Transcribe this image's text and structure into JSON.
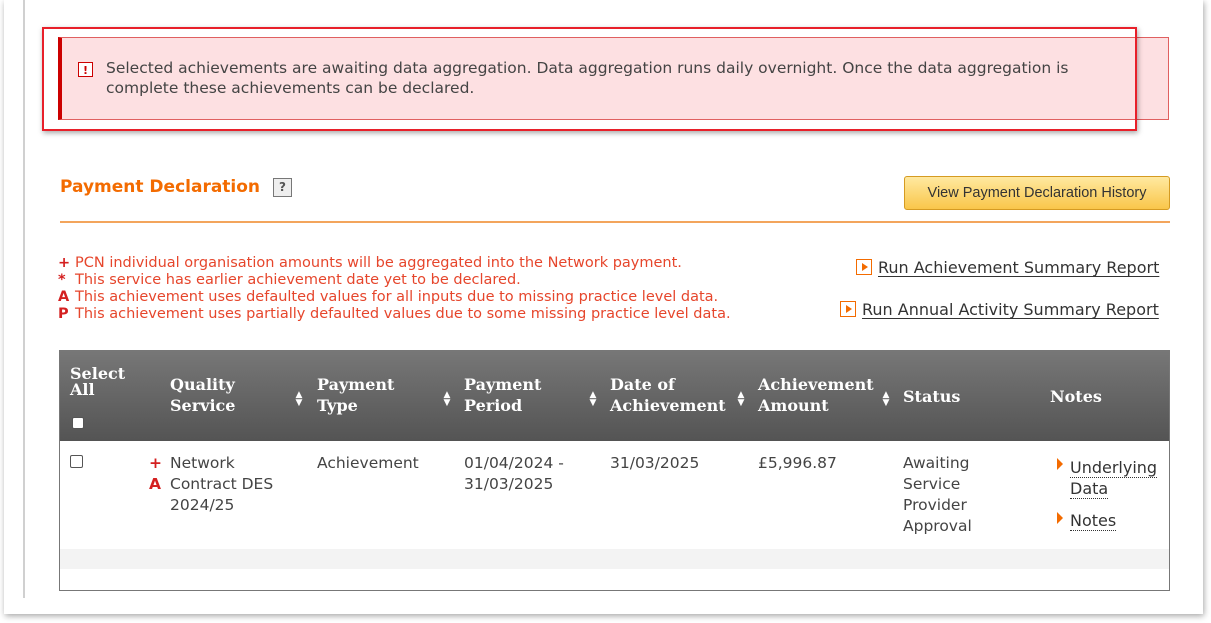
{
  "alert": {
    "icon": "exclamation-icon",
    "message": "Selected achievements are awaiting data aggregation. Data aggregation runs daily overnight. Once the data aggregation is complete these achievements can be declared."
  },
  "section": {
    "title": "Payment Declaration",
    "help_icon": "?",
    "history_button": "View Payment Declaration History"
  },
  "legend": [
    {
      "marker": "+",
      "text": "PCN individual organisation amounts will be aggregated into the Network payment."
    },
    {
      "marker": "*",
      "text": "This service has earlier achievement date yet to be declared."
    },
    {
      "marker": "A",
      "text": "This achievement uses defaulted values for all inputs due to missing practice level data."
    },
    {
      "marker": "P",
      "text": "This achievement uses partially defaulted values due to some missing practice level data."
    }
  ],
  "reports": {
    "achievement_summary": "Run Achievement Summary Report",
    "annual_activity": "Run Annual Activity Summary Report"
  },
  "table": {
    "headers": {
      "select_all_1": "Select",
      "select_all_2": "All",
      "quality_1": "Quality",
      "quality_2": "Service",
      "ptype_1": "Payment",
      "ptype_2": "Type",
      "pperiod_1": "Payment",
      "pperiod_2": "Period",
      "date_1": "Date of",
      "date_2": "Achievement",
      "amount_1": "Achievement",
      "amount_2": "Amount",
      "status": "Status",
      "notes": "Notes"
    },
    "rows": [
      {
        "mark_plus": "+",
        "mark_a": "A",
        "service_1": "Network",
        "service_2": "Contract DES",
        "service_3": "2024/25",
        "payment_type": "Achievement",
        "period_1": "01/04/2024 -",
        "period_2": "31/03/2025",
        "date": "31/03/2025",
        "amount": "£5,996.87",
        "status_1": "Awaiting",
        "status_2": "Service",
        "status_3": "Provider",
        "status_4": "Approval",
        "link_underlying_1": "Underlying",
        "link_underlying_2": "Data",
        "link_notes": "Notes"
      }
    ]
  },
  "colors": {
    "accent": "#f36b00",
    "alert_bg": "#fde0e2",
    "alert_border": "#cc0000",
    "legend_text": "#e6462c",
    "header_bg": "#5e5e5e"
  }
}
